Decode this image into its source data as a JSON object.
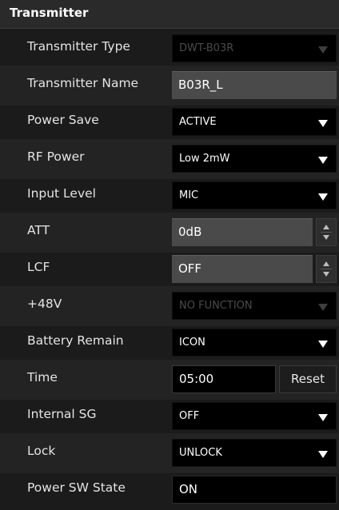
{
  "header": {
    "title": "Transmitter"
  },
  "fields": {
    "transmitter_type": {
      "label": "Transmitter Type",
      "value": "DWT-B03R"
    },
    "transmitter_name": {
      "label": "Transmitter Name",
      "value": "B03R_L"
    },
    "power_save": {
      "label": "Power Save",
      "value": "ACTIVE"
    },
    "rf_power": {
      "label": "RF Power",
      "value": "Low 2mW"
    },
    "input_level": {
      "label": "Input Level",
      "value": "MIC"
    },
    "att": {
      "label": "ATT",
      "value": "0dB"
    },
    "lcf": {
      "label": "LCF",
      "value": "OFF"
    },
    "phantom": {
      "label": "+48V",
      "value": "NO FUNCTION"
    },
    "battery_remain": {
      "label": "Battery Remain",
      "value": "ICON"
    },
    "time": {
      "label": "Time",
      "value": "05:00",
      "reset_label": "Reset"
    },
    "internal_sg": {
      "label": "Internal SG",
      "value": "OFF"
    },
    "lock": {
      "label": "Lock",
      "value": "UNLOCK"
    },
    "power_sw_state": {
      "label": "Power SW State",
      "value": "ON"
    }
  },
  "colors": {
    "background": "#1b1b1b",
    "header": "#2a2a2a",
    "select_bg": "#000000",
    "text_field_bg": "#4a4a4a",
    "disabled_text": "#4a4a4a"
  }
}
